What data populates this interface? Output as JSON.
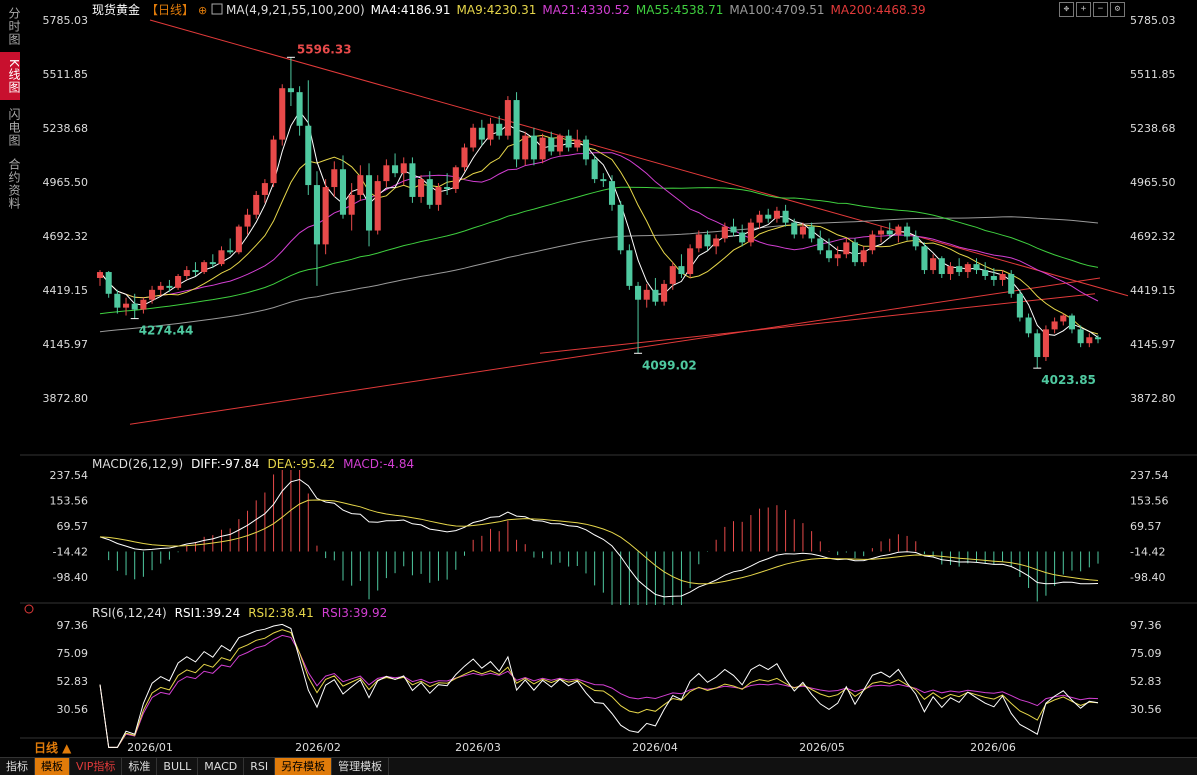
{
  "side_tabs": [
    "分时图",
    "K线图",
    "闪电图",
    "合约资料"
  ],
  "active_side_tab": 1,
  "header": {
    "symbol": "现货黄金",
    "period": "【日线】",
    "ma_label": "MA(4,9,21,55,100,200)",
    "ma_values": [
      {
        "text": "MA4:4186.91",
        "color": "#ffffff"
      },
      {
        "text": "MA9:4230.31",
        "color": "#e6d64a"
      },
      {
        "text": "MA21:4330.52",
        "color": "#d23fd2"
      },
      {
        "text": "MA55:4538.71",
        "color": "#3fcf3f"
      },
      {
        "text": "MA100:4709.51",
        "color": "#9a9a9a"
      },
      {
        "text": "MA200:4468.39",
        "color": "#e23a3a"
      }
    ]
  },
  "tool_icons": [
    "move-icon",
    "zoom-in-icon",
    "zoom-out-icon",
    "settings-icon"
  ],
  "colors": {
    "up": "#e84a4a",
    "down": "#4fc9a0",
    "text_up": "#e84a4a",
    "text_down": "#4fc9a0",
    "grid": "#2a2a2a"
  },
  "macd": {
    "label": "MACD(26,12,9)",
    "diff": "DIFF:-97.84",
    "dea": "DEA:-95.42",
    "macd": "MACD:-4.84"
  },
  "rsi": {
    "label": "RSI(6,12,24)",
    "rsi1": "RSI1:39.24",
    "rsi2": "RSI2:38.41",
    "rsi3": "RSI3:39.92"
  },
  "bottom_left_label": "日线 ▲",
  "bottom_tabs": [
    "指标",
    "模板",
    "VIP指标",
    "标准",
    "BULL",
    "MACD",
    "RSI",
    "另存模板",
    "管理模板"
  ],
  "chart_data": [
    {
      "type": "candlestick",
      "title": "现货黄金 日线",
      "y_ticks": [
        "5785.03",
        "5511.85",
        "5238.68",
        "4965.50",
        "4692.32",
        "4419.15",
        "4145.97",
        "3872.80"
      ],
      "ylim": [
        3872.8,
        5785.03
      ],
      "x_ticks": [
        "2026/01",
        "2026/02",
        "2026/03",
        "2026/04",
        "2026/05",
        "2026/06"
      ],
      "annotations": [
        {
          "text": "5596.33",
          "value": 5596.33,
          "kind": "high"
        },
        {
          "text": "4274.44",
          "value": 4274.44,
          "kind": "low"
        },
        {
          "text": "4099.02",
          "value": 4099.02,
          "kind": "low"
        },
        {
          "text": "4023.85",
          "value": 4023.85,
          "kind": "low"
        }
      ],
      "candles": [
        [
          4480,
          4520,
          4440,
          4510
        ],
        [
          4510,
          4515,
          4380,
          4400
        ],
        [
          4400,
          4420,
          4300,
          4330
        ],
        [
          4330,
          4380,
          4290,
          4350
        ],
        [
          4350,
          4400,
          4274.44,
          4320
        ],
        [
          4320,
          4380,
          4300,
          4370
        ],
        [
          4370,
          4440,
          4350,
          4420
        ],
        [
          4420,
          4460,
          4390,
          4440
        ],
        [
          4440,
          4470,
          4410,
          4430
        ],
        [
          4430,
          4500,
          4420,
          4490
        ],
        [
          4490,
          4540,
          4470,
          4520
        ],
        [
          4520,
          4560,
          4490,
          4510
        ],
        [
          4510,
          4570,
          4500,
          4560
        ],
        [
          4560,
          4600,
          4530,
          4550
        ],
        [
          4550,
          4640,
          4540,
          4620
        ],
        [
          4620,
          4680,
          4600,
          4610
        ],
        [
          4610,
          4750,
          4600,
          4740
        ],
        [
          4740,
          4830,
          4700,
          4800
        ],
        [
          4800,
          4920,
          4780,
          4900
        ],
        [
          4900,
          4980,
          4860,
          4960
        ],
        [
          4960,
          5200,
          4940,
          5180
        ],
        [
          5180,
          5460,
          5150,
          5440
        ],
        [
          5440,
          5596.33,
          5350,
          5420
        ],
        [
          5420,
          5450,
          5200,
          5250
        ],
        [
          5250,
          5480,
          4900,
          4950
        ],
        [
          4950,
          5020,
          4440,
          4650
        ],
        [
          4650,
          4980,
          4600,
          4940
        ],
        [
          4940,
          5070,
          4890,
          5030
        ],
        [
          5030,
          5100,
          4780,
          4800
        ],
        [
          4800,
          4960,
          4720,
          4900
        ],
        [
          4900,
          5050,
          4870,
          5000
        ],
        [
          5000,
          5060,
          4640,
          4720
        ],
        [
          4720,
          5000,
          4700,
          4970
        ],
        [
          4970,
          5080,
          4940,
          5050
        ],
        [
          5050,
          5110,
          4990,
          5010
        ],
        [
          5010,
          5090,
          4950,
          5060
        ],
        [
          5060,
          5090,
          4860,
          4890
        ],
        [
          4890,
          5000,
          4860,
          4980
        ],
        [
          4980,
          5020,
          4830,
          4850
        ],
        [
          4850,
          4960,
          4820,
          4940
        ],
        [
          4940,
          5010,
          4900,
          4930
        ],
        [
          4930,
          5050,
          4910,
          5040
        ],
        [
          5040,
          5160,
          5020,
          5140
        ],
        [
          5140,
          5260,
          5120,
          5240
        ],
        [
          5240,
          5280,
          5150,
          5180
        ],
        [
          5180,
          5290,
          5150,
          5260
        ],
        [
          5260,
          5300,
          5180,
          5200
        ],
        [
          5200,
          5400,
          5180,
          5380
        ],
        [
          5380,
          5420,
          5040,
          5080
        ],
        [
          5080,
          5220,
          5050,
          5200
        ],
        [
          5200,
          5240,
          5050,
          5080
        ],
        [
          5080,
          5210,
          5060,
          5190
        ],
        [
          5190,
          5220,
          5100,
          5120
        ],
        [
          5120,
          5210,
          5100,
          5200
        ],
        [
          5200,
          5230,
          5120,
          5140
        ],
        [
          5140,
          5230,
          5120,
          5180
        ],
        [
          5180,
          5200,
          5050,
          5080
        ],
        [
          5080,
          5100,
          4960,
          4980
        ],
        [
          4980,
          5010,
          4940,
          4970
        ],
        [
          4970,
          5000,
          4820,
          4850
        ],
        [
          4850,
          4870,
          4600,
          4620
        ],
        [
          4620,
          4650,
          4420,
          4440
        ],
        [
          4440,
          4460,
          4099.02,
          4370
        ],
        [
          4370,
          4450,
          4330,
          4420
        ],
        [
          4420,
          4480,
          4340,
          4360
        ],
        [
          4360,
          4470,
          4340,
          4450
        ],
        [
          4450,
          4560,
          4420,
          4540
        ],
        [
          4540,
          4600,
          4480,
          4500
        ],
        [
          4500,
          4650,
          4480,
          4630
        ],
        [
          4630,
          4720,
          4610,
          4700
        ],
        [
          4700,
          4720,
          4620,
          4640
        ],
        [
          4640,
          4700,
          4600,
          4680
        ],
        [
          4680,
          4760,
          4660,
          4740
        ],
        [
          4740,
          4780,
          4690,
          4710
        ],
        [
          4710,
          4750,
          4640,
          4660
        ],
        [
          4660,
          4780,
          4640,
          4760
        ],
        [
          4760,
          4820,
          4730,
          4800
        ],
        [
          4800,
          4830,
          4760,
          4780
        ],
        [
          4780,
          4840,
          4760,
          4820
        ],
        [
          4820,
          4850,
          4740,
          4760
        ],
        [
          4760,
          4780,
          4680,
          4700
        ],
        [
          4700,
          4760,
          4680,
          4740
        ],
        [
          4740,
          4760,
          4660,
          4680
        ],
        [
          4680,
          4720,
          4600,
          4620
        ],
        [
          4620,
          4680,
          4560,
          4580
        ],
        [
          4580,
          4640,
          4540,
          4600
        ],
        [
          4600,
          4680,
          4580,
          4660
        ],
        [
          4660,
          4680,
          4540,
          4560
        ],
        [
          4560,
          4640,
          4540,
          4620
        ],
        [
          4620,
          4720,
          4600,
          4700
        ],
        [
          4700,
          4740,
          4660,
          4720
        ],
        [
          4720,
          4760,
          4680,
          4700
        ],
        [
          4700,
          4750,
          4660,
          4740
        ],
        [
          4740,
          4760,
          4670,
          4690
        ],
        [
          4690,
          4720,
          4620,
          4640
        ],
        [
          4640,
          4660,
          4500,
          4520
        ],
        [
          4520,
          4600,
          4500,
          4580
        ],
        [
          4580,
          4590,
          4480,
          4500
        ],
        [
          4500,
          4560,
          4470,
          4540
        ],
        [
          4540,
          4580,
          4490,
          4510
        ],
        [
          4510,
          4560,
          4480,
          4550
        ],
        [
          4550,
          4580,
          4500,
          4520
        ],
        [
          4520,
          4560,
          4470,
          4490
        ],
        [
          4490,
          4530,
          4440,
          4470
        ],
        [
          4470,
          4520,
          4440,
          4500
        ],
        [
          4500,
          4520,
          4380,
          4400
        ],
        [
          4400,
          4420,
          4260,
          4280
        ],
        [
          4280,
          4300,
          4180,
          4200
        ],
        [
          4200,
          4220,
          4023.85,
          4080
        ],
        [
          4080,
          4240,
          4060,
          4220
        ],
        [
          4220,
          4280,
          4200,
          4260
        ],
        [
          4260,
          4300,
          4240,
          4290
        ],
        [
          4290,
          4300,
          4200,
          4220
        ],
        [
          4220,
          4240,
          4130,
          4150
        ],
        [
          4150,
          4200,
          4130,
          4180
        ],
        [
          4180,
          4190,
          4150,
          4170
        ]
      ]
    },
    {
      "type": "bar+line",
      "title": "MACD(26,12,9)",
      "y_ticks": [
        "237.54",
        "153.56",
        "69.57",
        "-14.42",
        "-98.40"
      ],
      "ylim": [
        -98.4,
        237.54
      ],
      "series": [
        {
          "name": "DIFF",
          "value_label": "-97.84"
        },
        {
          "name": "DEA",
          "value_label": "-95.42"
        },
        {
          "name": "MACD",
          "value_label": "-4.84"
        }
      ]
    },
    {
      "type": "line",
      "title": "RSI(6,12,24)",
      "y_ticks": [
        "97.36",
        "75.09",
        "52.83",
        "30.56"
      ],
      "ylim": [
        30.56,
        97.36
      ],
      "series": [
        {
          "name": "RSI1",
          "value_label": "39.24"
        },
        {
          "name": "RSI2",
          "value_label": "38.41"
        },
        {
          "name": "RSI3",
          "value_label": "39.92"
        }
      ]
    }
  ]
}
